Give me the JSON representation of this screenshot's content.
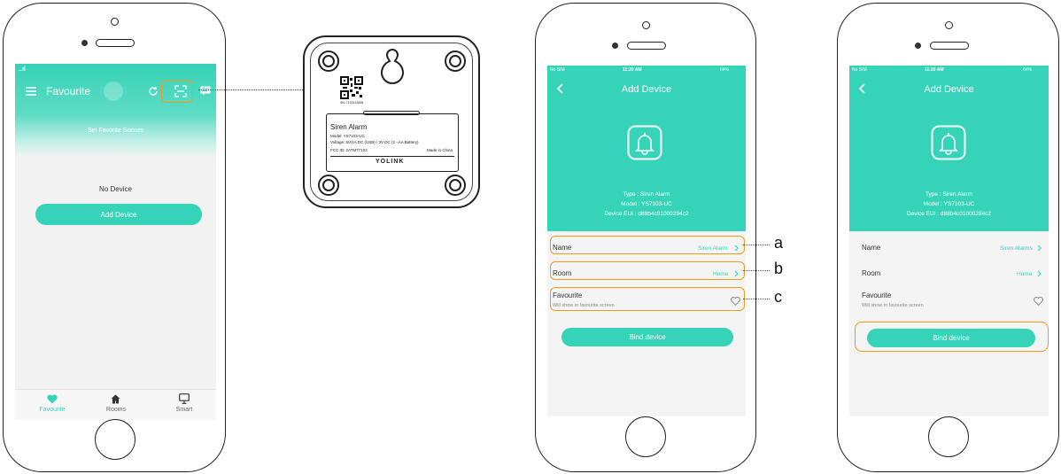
{
  "phone1": {
    "signal": "..ıl",
    "title": "Favourite",
    "banner": "Set Favorite Scenes",
    "empty_text": "No Device",
    "add_button": "Add Device",
    "tabs": [
      "Favourite",
      "Rooms",
      "Smart"
    ]
  },
  "device": {
    "sn": "SN: 7103123456",
    "name": "Siren Alarm",
    "model": "Model:   YS7103-UC",
    "voltage": "Voltage:  5V/1A DC (USB) / 3V DC (2 - AA Battery)",
    "fcc": "FCC ID:   2ATM77103",
    "made": "Made in China",
    "brand": "YOLINK"
  },
  "phone2": {
    "status_left": "No SIM",
    "time": "11:20 AM",
    "battery": "64%",
    "title": "Add Device",
    "type": "Type : Siren Alarm",
    "model": "Model : YS7103-UC",
    "eui": "Device EUI : d88b4c01000294c2",
    "name_label": "Name",
    "name_value": "Siren Alarm",
    "room_label": "Room",
    "room_value": "Home",
    "fav_label": "Favourite",
    "fav_sub": "Will show in favourite screen",
    "bind": "Bind device",
    "callouts": [
      "a",
      "b",
      "c"
    ]
  },
  "phone3": {
    "status_left": "No SIM",
    "time": "11:20 AM",
    "battery": "64%",
    "title": "Add Device",
    "type": "Type : Siren Alarm",
    "model": "Model : YS7103-UC",
    "eui": "Device EUI : d88b4c01000294c2",
    "name_label": "Name",
    "name_value": "Siren Alarms",
    "room_label": "Room",
    "room_value": "Home",
    "fav_label": "Favourite",
    "fav_sub": "Will show in favourite screen",
    "bind": "Bind device"
  },
  "colors": {
    "accent": "#35d3b7",
    "highlight": "#f39a1c",
    "link_line": "#1f4e9c"
  },
  "icons": [
    "menu-icon",
    "refresh-icon",
    "scan-icon",
    "message-icon",
    "heart-icon",
    "home-icon",
    "monitor-icon",
    "back-icon",
    "bell-icon",
    "chevron-right-icon",
    "heart-outline-icon"
  ]
}
